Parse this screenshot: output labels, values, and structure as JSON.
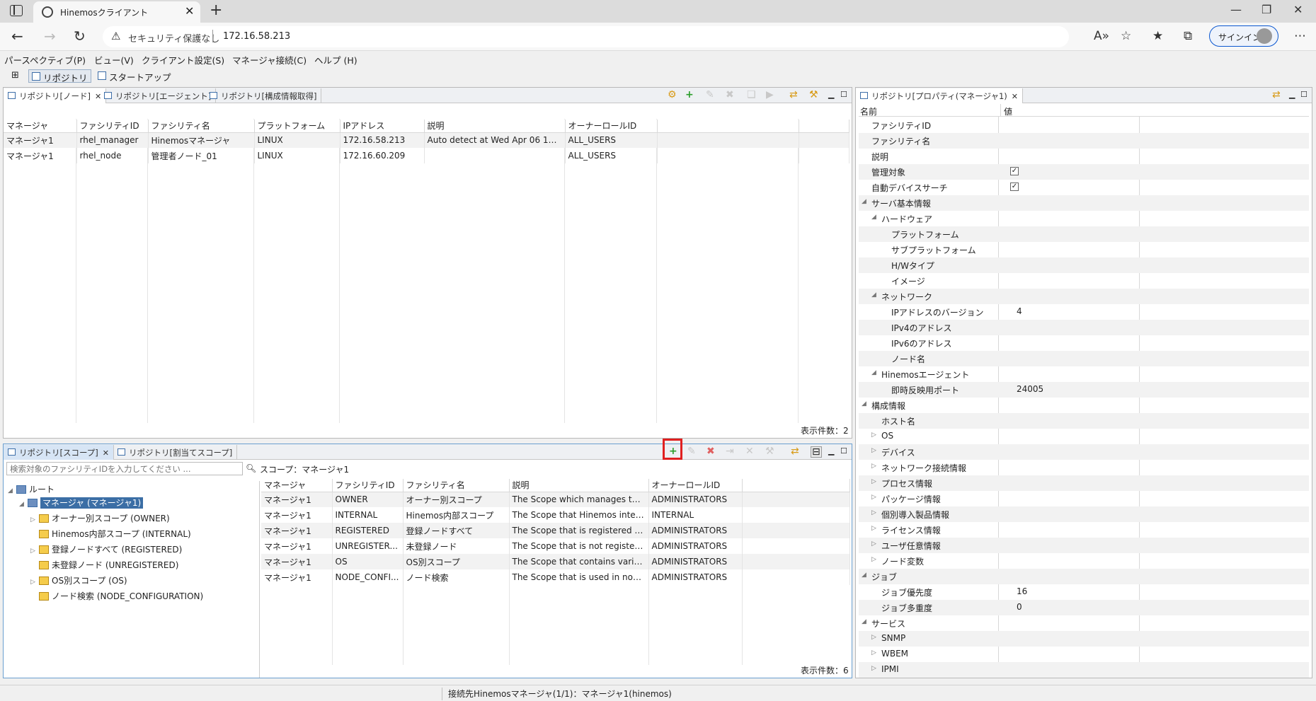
{
  "browser": {
    "tab_title": "Hinemosクライアント",
    "security_label": "セキュリティ保護なし",
    "url": "172.16.58.213",
    "signin_label": "サインイン"
  },
  "menubar": [
    "パースペクティブ(P)",
    "ビュー(V)",
    "クライアント設定(S)",
    "マネージャ接続(C)",
    "ヘルプ (H)"
  ],
  "perspectives": [
    "リポジトリ",
    "スタートアップ"
  ],
  "node_panel": {
    "tabs": [
      "リポジトリ[ノード]",
      "リポジトリ[エージェント]",
      "リポジトリ[構成情報取得]"
    ],
    "headers": [
      "マネージャ",
      "ファシリティID",
      "ファシリティ名",
      "プラットフォーム",
      "IPアドレス",
      "説明",
      "オーナーロールID"
    ],
    "rows": [
      [
        "マネージャ1",
        "rhel_manager",
        "Hinemosマネージャ",
        "LINUX",
        "172.16.58.213",
        "Auto detect at Wed Apr 06 12...",
        "ALL_USERS"
      ],
      [
        "マネージャ1",
        "rhel_node",
        "管理者ノード_01",
        "LINUX",
        "172.16.60.209",
        "",
        "ALL_USERS"
      ]
    ],
    "count": "表示件数：2"
  },
  "scope_panel": {
    "tabs": [
      "リポジトリ[スコープ]",
      "リポジトリ[割当てスコープ]"
    ],
    "search_placeholder": "検索対象のファシリティIDを入力してください ...",
    "scope_label": "スコープ：マネージャ1",
    "tree": [
      {
        "label": "ルート",
        "level": 0,
        "twisty": "◢"
      },
      {
        "label": "マネージャ (マネージャ1)",
        "level": 1,
        "twisty": "◢",
        "selected": true
      },
      {
        "label": "オーナー別スコープ (OWNER)",
        "level": 2,
        "twisty": "▷"
      },
      {
        "label": "Hinemos内部スコープ (INTERNAL)",
        "level": 2,
        "twisty": ""
      },
      {
        "label": "登録ノードすべて (REGISTERED)",
        "level": 2,
        "twisty": "▷"
      },
      {
        "label": "未登録ノード (UNREGISTERED)",
        "level": 2,
        "twisty": ""
      },
      {
        "label": "OS別スコープ (OS)",
        "level": 2,
        "twisty": "▷"
      },
      {
        "label": "ノード検索 (NODE_CONFIGURATION)",
        "level": 2,
        "twisty": ""
      }
    ],
    "headers": [
      "マネージャ",
      "ファシリティID",
      "ファシリティ名",
      "説明",
      "オーナーロールID"
    ],
    "rows": [
      [
        "マネージャ1",
        "OWNER",
        "オーナー別スコープ",
        "The Scope which manages the...",
        "ADMINISTRATORS"
      ],
      [
        "マネージャ1",
        "INTERNAL",
        "Hinemos内部スコープ",
        "The Scope that Hinemos inter...",
        "INTERNAL"
      ],
      [
        "マネージャ1",
        "REGISTERED",
        "登録ノードすべて",
        "The Scope that is registered a...",
        "ADMINISTRATORS"
      ],
      [
        "マネージャ1",
        "UNREGISTER...",
        "未登録ノード",
        "The Scope that is not register...",
        "ADMINISTRATORS"
      ],
      [
        "マネージャ1",
        "OS",
        "OS別スコープ",
        "The Scope that contains vario...",
        "ADMINISTRATORS"
      ],
      [
        "マネージャ1",
        "NODE_CONFI...",
        "ノード検索",
        "The Scope that is used in nod...",
        "ADMINISTRATORS"
      ]
    ],
    "count": "表示件数：6"
  },
  "property_panel": {
    "tab": "リポジトリ[プロパティ(マネージャ1)",
    "headers": [
      "名前",
      "値"
    ],
    "rows": [
      {
        "name": "ファシリティID",
        "level": 0,
        "twisty": "",
        "value": ""
      },
      {
        "name": "ファシリティ名",
        "level": 0,
        "twisty": "",
        "value": ""
      },
      {
        "name": "説明",
        "level": 0,
        "twisty": "",
        "value": ""
      },
      {
        "name": "管理対象",
        "level": 0,
        "twisty": "",
        "value": "",
        "check": true
      },
      {
        "name": "自動デバイスサーチ",
        "level": 0,
        "twisty": "",
        "value": "",
        "check": true
      },
      {
        "name": "サーバ基本情報",
        "level": 0,
        "twisty": "◢",
        "value": ""
      },
      {
        "name": "ハードウェア",
        "level": 1,
        "twisty": "◢",
        "value": ""
      },
      {
        "name": "プラットフォーム",
        "level": 2,
        "twisty": "",
        "value": ""
      },
      {
        "name": "サブプラットフォーム",
        "level": 2,
        "twisty": "",
        "value": ""
      },
      {
        "name": "H/Wタイプ",
        "level": 2,
        "twisty": "",
        "value": ""
      },
      {
        "name": "イメージ",
        "level": 2,
        "twisty": "",
        "value": ""
      },
      {
        "name": "ネットワーク",
        "level": 1,
        "twisty": "◢",
        "value": ""
      },
      {
        "name": "IPアドレスのバージョン",
        "level": 2,
        "twisty": "",
        "value": "4"
      },
      {
        "name": "IPv4のアドレス",
        "level": 2,
        "twisty": "",
        "value": ""
      },
      {
        "name": "IPv6のアドレス",
        "level": 2,
        "twisty": "",
        "value": ""
      },
      {
        "name": "ノード名",
        "level": 2,
        "twisty": "",
        "value": ""
      },
      {
        "name": "Hinemosエージェント",
        "level": 1,
        "twisty": "◢",
        "value": ""
      },
      {
        "name": "即時反映用ポート",
        "level": 2,
        "twisty": "",
        "value": "24005"
      },
      {
        "name": "構成情報",
        "level": 0,
        "twisty": "◢",
        "value": ""
      },
      {
        "name": "ホスト名",
        "level": 1,
        "twisty": "",
        "value": ""
      },
      {
        "name": "OS",
        "level": 1,
        "twisty": "▷",
        "value": ""
      },
      {
        "name": "デバイス",
        "level": 1,
        "twisty": "▷",
        "value": ""
      },
      {
        "name": "ネットワーク接続情報",
        "level": 1,
        "twisty": "▷",
        "value": ""
      },
      {
        "name": "プロセス情報",
        "level": 1,
        "twisty": "▷",
        "value": ""
      },
      {
        "name": "パッケージ情報",
        "level": 1,
        "twisty": "▷",
        "value": ""
      },
      {
        "name": "個別導入製品情報",
        "level": 1,
        "twisty": "▷",
        "value": ""
      },
      {
        "name": "ライセンス情報",
        "level": 1,
        "twisty": "▷",
        "value": ""
      },
      {
        "name": "ユーザ任意情報",
        "level": 1,
        "twisty": "▷",
        "value": ""
      },
      {
        "name": "ノード変数",
        "level": 1,
        "twisty": "▷",
        "value": ""
      },
      {
        "name": "ジョブ",
        "level": 0,
        "twisty": "◢",
        "value": ""
      },
      {
        "name": "ジョブ優先度",
        "level": 1,
        "twisty": "",
        "value": "16"
      },
      {
        "name": "ジョブ多重度",
        "level": 1,
        "twisty": "",
        "value": "0"
      },
      {
        "name": "サービス",
        "level": 0,
        "twisty": "◢",
        "value": ""
      },
      {
        "name": "SNMP",
        "level": 1,
        "twisty": "▷",
        "value": ""
      },
      {
        "name": "WBEM",
        "level": 1,
        "twisty": "▷",
        "value": ""
      },
      {
        "name": "IPMI",
        "level": 1,
        "twisty": "▷",
        "value": ""
      }
    ]
  },
  "status": "接続先Hinemosマネージャ(1/1)：マネージャ1(hinemos)",
  "colors": {
    "accent": "#3d6ea8",
    "highlight": "#e02020",
    "selected": "#3b6ea5"
  }
}
